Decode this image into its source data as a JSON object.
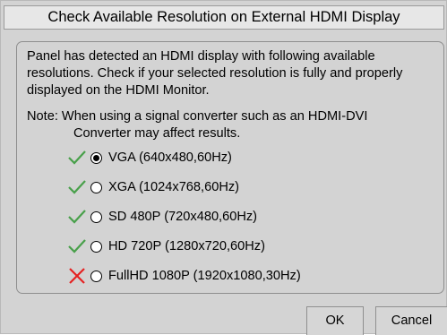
{
  "dialog": {
    "title": "Check Available Resolution on External HDMI Display",
    "intro": "Panel has detected an HDMI display with following available resolutions. Check if your selected resolution is fully and properly displayed on the HDMI Monitor.",
    "note_line1": "Note: When using a signal converter such as an HDMI-DVI",
    "note_line2": "Converter may affect results.",
    "resolutions": [
      {
        "label": "VGA (640x480,60Hz)",
        "status": "check-icon",
        "selected": true
      },
      {
        "label": "XGA (1024x768,60Hz)",
        "status": "check-icon",
        "selected": false
      },
      {
        "label": "SD 480P (720x480,60Hz)",
        "status": "check-icon",
        "selected": false
      },
      {
        "label": "HD 720P (1280x720,60Hz)",
        "status": "check-icon",
        "selected": false
      },
      {
        "label": "FullHD 1080P (1920x1080,30Hz)",
        "status": "cross-icon",
        "selected": false
      }
    ],
    "ok_label": "OK",
    "cancel_label": "Cancel"
  },
  "colors": {
    "check": "#48a04a",
    "cross": "#e52222",
    "background": "#d3d3d3"
  }
}
